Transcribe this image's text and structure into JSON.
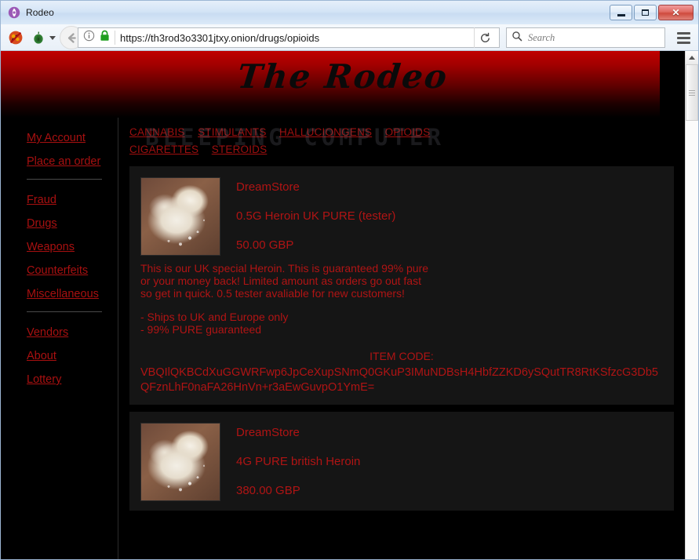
{
  "window": {
    "title": "Rodeo",
    "icon": "tor-browser-icon",
    "controls": {
      "minimize": "minimize",
      "maximize": "maximize",
      "close": "close"
    }
  },
  "toolbar": {
    "noscript_icon": "noscript-icon",
    "torbutton_icon": "onion-icon",
    "back_icon": "back-arrow-icon",
    "info_icon": "info-icon",
    "lock_icon": "padlock-icon",
    "url": "https://th3rod3o3301jtxy.onion/drugs/opioids",
    "reload_icon": "reload-icon",
    "search_icon": "search-icon",
    "search_value": "",
    "search_placeholder": "Search",
    "menu_icon": "hamburger-menu-icon"
  },
  "site": {
    "banner_title": "The Rodeo",
    "watermark": "BLEEPING\nCOMPUTER",
    "accent": "#b01414",
    "link_color": "#a81010",
    "background": "#000000"
  },
  "sidebar": {
    "groups": [
      {
        "items": [
          {
            "label": "My Account",
            "name": "sidebar-item-my-account"
          },
          {
            "label": "Place an order",
            "name": "sidebar-item-place-an-order"
          }
        ]
      },
      {
        "items": [
          {
            "label": "Fraud",
            "name": "sidebar-item-fraud"
          },
          {
            "label": "Drugs",
            "name": "sidebar-item-drugs"
          },
          {
            "label": "Weapons",
            "name": "sidebar-item-weapons"
          },
          {
            "label": "Counterfeits",
            "name": "sidebar-item-counterfeits"
          },
          {
            "label": "Miscellaneous",
            "name": "sidebar-item-miscellaneous"
          }
        ]
      },
      {
        "items": [
          {
            "label": "Vendors",
            "name": "sidebar-item-vendors"
          },
          {
            "label": "About",
            "name": "sidebar-item-about"
          },
          {
            "label": "Lottery",
            "name": "sidebar-item-lottery"
          }
        ]
      }
    ]
  },
  "topnav": {
    "items": [
      "CANNABIS",
      "STIMULANTS",
      "HALLUCIONGENS",
      "OPIOIDS",
      "CIGARETTES",
      "STEROIDS"
    ]
  },
  "listings": [
    {
      "vendor": "DreamStore",
      "product": "0.5G Heroin UK PURE (tester)",
      "price": "50.00 GBP",
      "description": "This is our UK special Heroin. This is guaranteed 99% pure\nor your money back! Limited amount as orders go out fast\nso get in quick. 0.5 tester avaliable for new customers!",
      "bullets": "- Ships to UK and Europe only\n- 99% PURE guaranteed",
      "item_code_label": "ITEM CODE:",
      "item_code": "VBQIlQKBCdXuGGWRFwp6JpCeXupSNmQ0GKuP3IMuNDBsH4HbfZZKD6ySQutTR8RtKSfzcG3Db5QFznLhF0naFA26HnVn+r3aEwGuvpO1YmE="
    },
    {
      "vendor": "DreamStore",
      "product": "4G PURE british Heroin",
      "price": "380.00 GBP",
      "description": "",
      "bullets": "",
      "item_code_label": "",
      "item_code": ""
    }
  ],
  "scrollbar": {
    "up_arrow": "scroll-up-arrow",
    "thumb": "scroll-thumb"
  }
}
